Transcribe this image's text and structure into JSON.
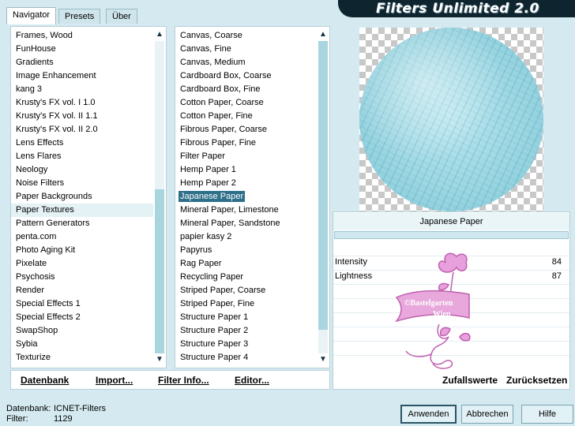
{
  "app": {
    "title": "Filters Unlimited 2.0"
  },
  "tabs": [
    "Navigator",
    "Presets",
    "Über"
  ],
  "categories": {
    "selected": "Paper Textures",
    "items": [
      "Frames, Wood",
      "FunHouse",
      "Gradients",
      "Image Enhancement",
      "kang 3",
      "Krusty's FX vol. I 1.0",
      "Krusty's FX vol. II 1.1",
      "Krusty's FX vol. II 2.0",
      "Lens Effects",
      "Lens Flares",
      "Neology",
      "Noise Filters",
      "Paper Backgrounds",
      "Paper Textures",
      "Pattern Generators",
      "penta.com",
      "Photo Aging Kit",
      "Pixelate",
      "Psychosis",
      "Render",
      "Special Effects 1",
      "Special Effects 2",
      "SwapShop",
      "Sybia",
      "Texturize"
    ]
  },
  "filters": {
    "selected": "Japanese Paper",
    "items": [
      "Canvas, Coarse",
      "Canvas, Fine",
      "Canvas, Medium",
      "Cardboard Box, Coarse",
      "Cardboard Box, Fine",
      "Cotton Paper, Coarse",
      "Cotton Paper, Fine",
      "Fibrous Paper, Coarse",
      "Fibrous Paper, Fine",
      "Filter Paper",
      "Hemp Paper 1",
      "Hemp Paper 2",
      "Japanese Paper",
      "Mineral Paper, Limestone",
      "Mineral Paper, Sandstone",
      "papier kasy 2",
      "Papyrus",
      "Rag Paper",
      "Recycling Paper",
      "Striped Paper, Coarse",
      "Striped Paper, Fine",
      "Structure Paper 1",
      "Structure Paper 2",
      "Structure Paper 3",
      "Structure Paper 4"
    ]
  },
  "toolbar": {
    "datenbank": "Datenbank",
    "import": "Import...",
    "filter_info": "Filter Info...",
    "editor": "Editor..."
  },
  "preview": {
    "filter_name": "Japanese Paper",
    "params": [
      {
        "label": "Intensity",
        "value": "84"
      },
      {
        "label": "Lightness",
        "value": "87"
      }
    ],
    "watermark_line1": "©Bastelgarten",
    "watermark_line2": "Wien"
  },
  "right_toolbar": {
    "random": "Zufallswerte",
    "reset": "Zurücksetzen"
  },
  "footer": {
    "db_label": "Datenbank:",
    "db_value": "ICNET-Filters",
    "filter_label": "Filter:",
    "filter_value": "1129"
  },
  "buttons": {
    "apply": "Anwenden",
    "cancel": "Abbrechen",
    "help": "Hilfe"
  },
  "colors": {
    "background": "#d4eaf0",
    "title_banner": "#0e2530",
    "selection": "#2e6f8a",
    "scroll_thumb": "#a9d5df",
    "watermark": "#d070c0"
  }
}
